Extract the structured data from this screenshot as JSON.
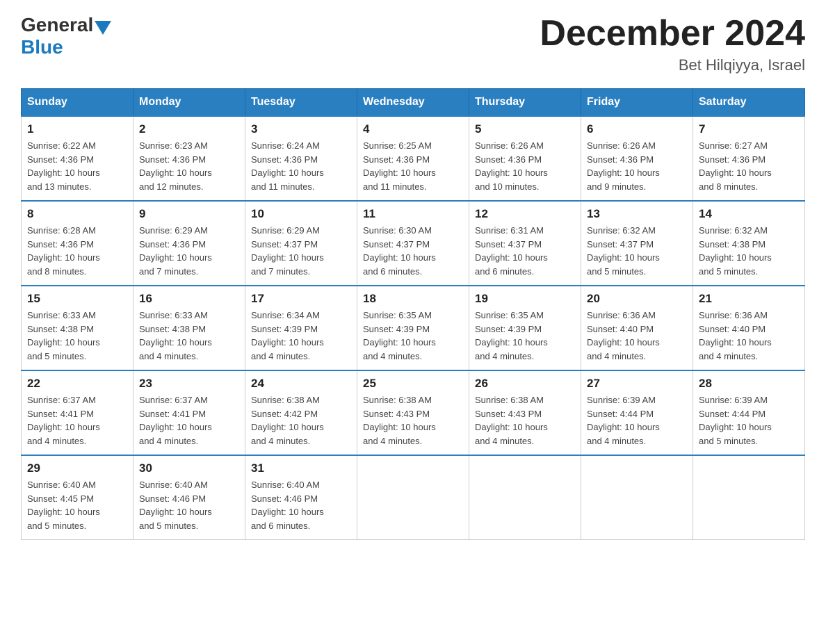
{
  "header": {
    "logo_general": "General",
    "logo_blue": "Blue",
    "month_title": "December 2024",
    "location": "Bet Hilqiyya, Israel"
  },
  "days_of_week": [
    "Sunday",
    "Monday",
    "Tuesday",
    "Wednesday",
    "Thursday",
    "Friday",
    "Saturday"
  ],
  "weeks": [
    [
      {
        "day": "1",
        "sunrise": "6:22 AM",
        "sunset": "4:36 PM",
        "daylight": "10 hours and 13 minutes."
      },
      {
        "day": "2",
        "sunrise": "6:23 AM",
        "sunset": "4:36 PM",
        "daylight": "10 hours and 12 minutes."
      },
      {
        "day": "3",
        "sunrise": "6:24 AM",
        "sunset": "4:36 PM",
        "daylight": "10 hours and 11 minutes."
      },
      {
        "day": "4",
        "sunrise": "6:25 AM",
        "sunset": "4:36 PM",
        "daylight": "10 hours and 11 minutes."
      },
      {
        "day": "5",
        "sunrise": "6:26 AM",
        "sunset": "4:36 PM",
        "daylight": "10 hours and 10 minutes."
      },
      {
        "day": "6",
        "sunrise": "6:26 AM",
        "sunset": "4:36 PM",
        "daylight": "10 hours and 9 minutes."
      },
      {
        "day": "7",
        "sunrise": "6:27 AM",
        "sunset": "4:36 PM",
        "daylight": "10 hours and 8 minutes."
      }
    ],
    [
      {
        "day": "8",
        "sunrise": "6:28 AM",
        "sunset": "4:36 PM",
        "daylight": "10 hours and 8 minutes."
      },
      {
        "day": "9",
        "sunrise": "6:29 AM",
        "sunset": "4:36 PM",
        "daylight": "10 hours and 7 minutes."
      },
      {
        "day": "10",
        "sunrise": "6:29 AM",
        "sunset": "4:37 PM",
        "daylight": "10 hours and 7 minutes."
      },
      {
        "day": "11",
        "sunrise": "6:30 AM",
        "sunset": "4:37 PM",
        "daylight": "10 hours and 6 minutes."
      },
      {
        "day": "12",
        "sunrise": "6:31 AM",
        "sunset": "4:37 PM",
        "daylight": "10 hours and 6 minutes."
      },
      {
        "day": "13",
        "sunrise": "6:32 AM",
        "sunset": "4:37 PM",
        "daylight": "10 hours and 5 minutes."
      },
      {
        "day": "14",
        "sunrise": "6:32 AM",
        "sunset": "4:38 PM",
        "daylight": "10 hours and 5 minutes."
      }
    ],
    [
      {
        "day": "15",
        "sunrise": "6:33 AM",
        "sunset": "4:38 PM",
        "daylight": "10 hours and 5 minutes."
      },
      {
        "day": "16",
        "sunrise": "6:33 AM",
        "sunset": "4:38 PM",
        "daylight": "10 hours and 4 minutes."
      },
      {
        "day": "17",
        "sunrise": "6:34 AM",
        "sunset": "4:39 PM",
        "daylight": "10 hours and 4 minutes."
      },
      {
        "day": "18",
        "sunrise": "6:35 AM",
        "sunset": "4:39 PM",
        "daylight": "10 hours and 4 minutes."
      },
      {
        "day": "19",
        "sunrise": "6:35 AM",
        "sunset": "4:39 PM",
        "daylight": "10 hours and 4 minutes."
      },
      {
        "day": "20",
        "sunrise": "6:36 AM",
        "sunset": "4:40 PM",
        "daylight": "10 hours and 4 minutes."
      },
      {
        "day": "21",
        "sunrise": "6:36 AM",
        "sunset": "4:40 PM",
        "daylight": "10 hours and 4 minutes."
      }
    ],
    [
      {
        "day": "22",
        "sunrise": "6:37 AM",
        "sunset": "4:41 PM",
        "daylight": "10 hours and 4 minutes."
      },
      {
        "day": "23",
        "sunrise": "6:37 AM",
        "sunset": "4:41 PM",
        "daylight": "10 hours and 4 minutes."
      },
      {
        "day": "24",
        "sunrise": "6:38 AM",
        "sunset": "4:42 PM",
        "daylight": "10 hours and 4 minutes."
      },
      {
        "day": "25",
        "sunrise": "6:38 AM",
        "sunset": "4:43 PM",
        "daylight": "10 hours and 4 minutes."
      },
      {
        "day": "26",
        "sunrise": "6:38 AM",
        "sunset": "4:43 PM",
        "daylight": "10 hours and 4 minutes."
      },
      {
        "day": "27",
        "sunrise": "6:39 AM",
        "sunset": "4:44 PM",
        "daylight": "10 hours and 4 minutes."
      },
      {
        "day": "28",
        "sunrise": "6:39 AM",
        "sunset": "4:44 PM",
        "daylight": "10 hours and 5 minutes."
      }
    ],
    [
      {
        "day": "29",
        "sunrise": "6:40 AM",
        "sunset": "4:45 PM",
        "daylight": "10 hours and 5 minutes."
      },
      {
        "day": "30",
        "sunrise": "6:40 AM",
        "sunset": "4:46 PM",
        "daylight": "10 hours and 5 minutes."
      },
      {
        "day": "31",
        "sunrise": "6:40 AM",
        "sunset": "4:46 PM",
        "daylight": "10 hours and 6 minutes."
      },
      null,
      null,
      null,
      null
    ]
  ],
  "labels": {
    "sunrise": "Sunrise:",
    "sunset": "Sunset:",
    "daylight": "Daylight:"
  }
}
